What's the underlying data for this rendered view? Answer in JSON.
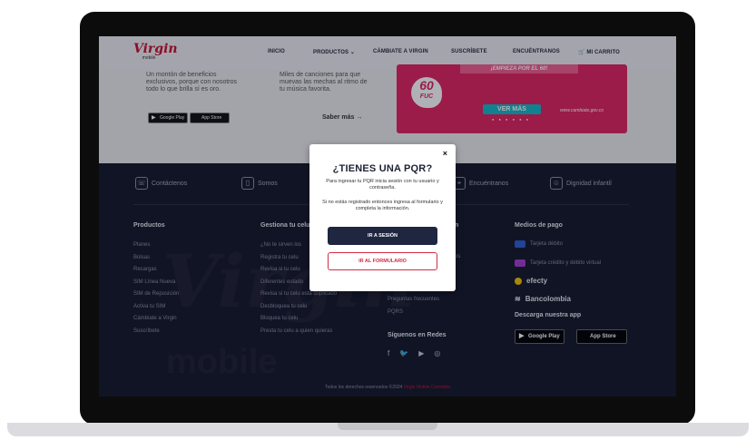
{
  "nav": {
    "logo_word": "Virgin",
    "logo_sub": "mobile",
    "items": [
      "INICIO",
      "PRODUCTOS ⌄",
      "CÁMBIATE A VIRGIN",
      "SUSCRÍBETE",
      "ENCUÉNTRANOS",
      "MI CARRITO"
    ]
  },
  "upper": {
    "col1_text": "Un montón de beneficios exclusivos, porque con nosotros todo lo que brilla sí es oro.",
    "col2_text": "Miles de canciones para que muevas las mechas al ritmo de tu música favorita.",
    "saber_mas": "Saber más →",
    "google_play": "Google Play",
    "app_store": "App Store",
    "banner": {
      "top_text": "¡EMPIEZA POR EL 60!",
      "badge_number": "60",
      "badge_word": "FUC",
      "cta": "VER MÁS",
      "url": "www.cambiate.gov.co",
      "dots": "● ● ● ● ● ●"
    }
  },
  "footer": {
    "shortcuts": [
      "Contáctenos",
      "Somos",
      "Encuéntranos",
      "Dignidad infantil"
    ],
    "columns": {
      "productos": {
        "title": "Productos",
        "items": [
          "Planes",
          "Bolsas",
          "Recargas",
          "SIM Línea Nueva",
          "SIM de Reposición",
          "Activa tu SIM",
          "Cámbiate a Virgin",
          "Suscríbete"
        ]
      },
      "gestiona": {
        "title": "Gestiona tu celu",
        "items": [
          "¿No te sirven los",
          "Registra tu celu",
          "Revisa si tu celu",
          "Diferentes estado",
          "Revisa si tu celu está duplicado",
          "Desbloquea tu celu",
          "Bloquea tu celu",
          "Presta tu celu a quien quieras"
        ]
      },
      "ayuda": {
        "title": "n",
        "items": [
          "os",
          "Preguntas frecuentes",
          "PQRS"
        ]
      },
      "siguenos_title": "Síguenos en Redes"
    },
    "pagos": {
      "title": "Medios de pago",
      "items": [
        "Tarjeta débito",
        "Tarjeta crédito y débito virtual",
        "efecty",
        "Bancolombia"
      ]
    },
    "descarga": {
      "title": "Descarga nuestra app",
      "google_play": "Google Play",
      "app_store": "App Store"
    },
    "copyright_prefix": "Todos los derechos reservados ©2024",
    "copyright_brand": "Virgin Mobile Colombia",
    "watermark": "Virgin",
    "watermark2": "mobile"
  },
  "modal": {
    "close": "×",
    "title": "¿TIENES UNA PQR?",
    "text1": "Para ingresar tu PQR inicia sesión con tu usuario y contraseña.",
    "text2": "Si no estás registrado entonces ingresa al formulario y completa la información.",
    "login_button": "IR A SESIÓN",
    "form_button": "IR AL FORMULARIO"
  },
  "colors": {
    "brand_red": "#c8102e",
    "footer_bg": "#15182a",
    "banner_pink": "#e0245e",
    "cta_teal": "#14b8c7",
    "modal_primary": "#1e2640"
  }
}
